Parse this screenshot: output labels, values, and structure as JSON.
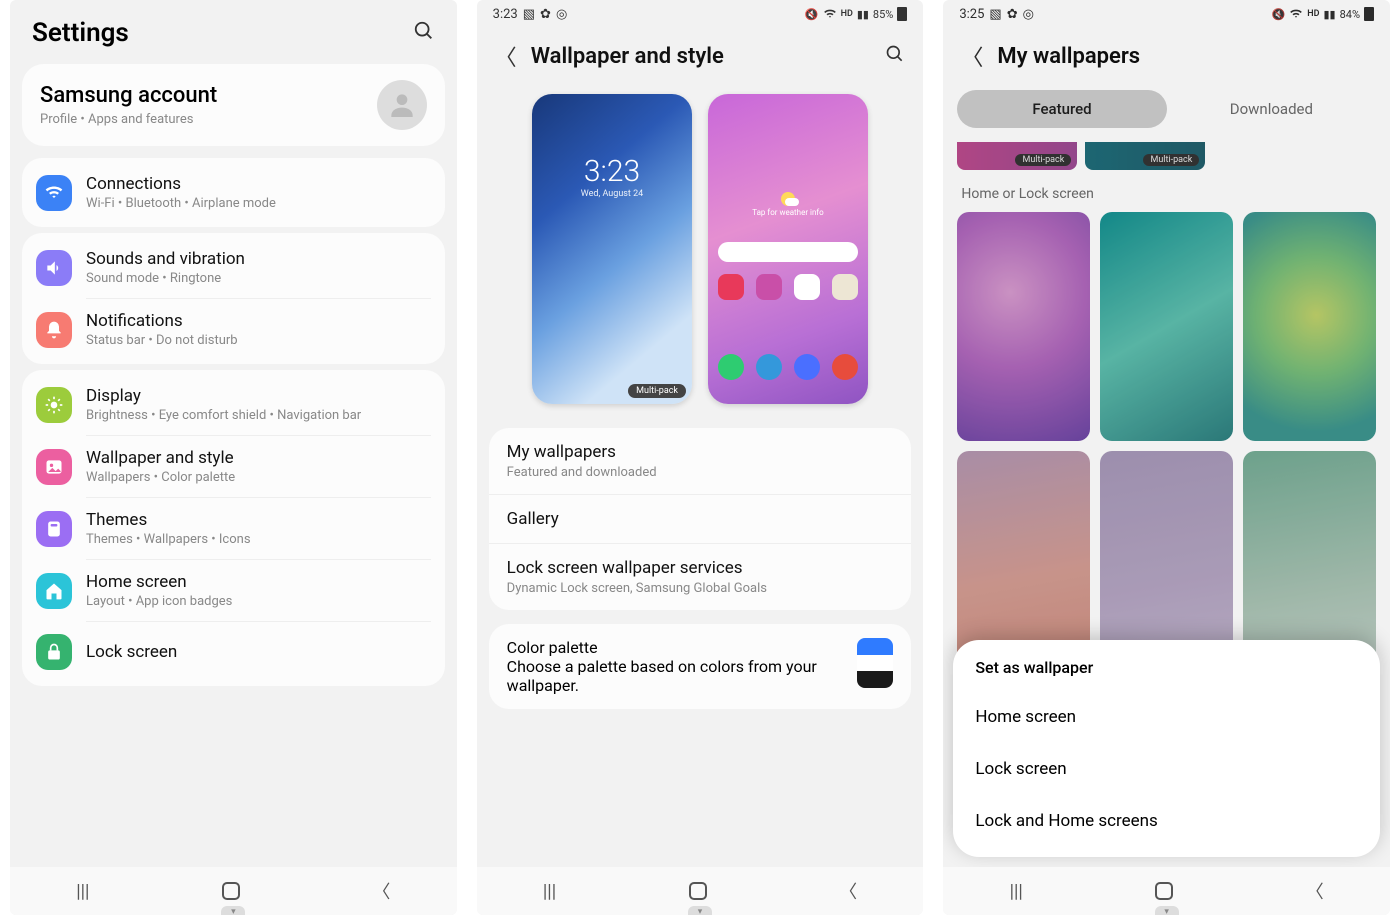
{
  "phone1": {
    "title": "Settings",
    "account": {
      "title": "Samsung account",
      "sub": "Profile  •  Apps and features"
    },
    "groups": [
      {
        "items": [
          {
            "icon": "wifi",
            "color": "#3b82f6",
            "title": "Connections",
            "sub": "Wi-Fi  •  Bluetooth  •  Airplane mode"
          }
        ]
      },
      {
        "items": [
          {
            "icon": "sound",
            "color": "#8b7cf7",
            "title": "Sounds and vibration",
            "sub": "Sound mode  •  Ringtone"
          },
          {
            "icon": "bell",
            "color": "#f77b72",
            "title": "Notifications",
            "sub": "Status bar  •  Do not disturb"
          }
        ]
      },
      {
        "items": [
          {
            "icon": "sun",
            "color": "#9ccc3c",
            "title": "Display",
            "sub": "Brightness  •  Eye comfort shield  •  Navigation bar"
          },
          {
            "icon": "image",
            "color": "#ec5fa0",
            "title": "Wallpaper and style",
            "sub": "Wallpapers  •  Color palette"
          },
          {
            "icon": "theme",
            "color": "#9b6ef3",
            "title": "Themes",
            "sub": "Themes  •  Wallpapers  •  Icons"
          },
          {
            "icon": "home",
            "color": "#2bc4d8",
            "title": "Home screen",
            "sub": "Layout  •  App icon badges"
          },
          {
            "icon": "lock",
            "color": "#35b36f",
            "title": "Lock screen",
            "sub": ""
          }
        ]
      }
    ]
  },
  "phone2": {
    "status": {
      "time": "3:23",
      "battery": "85%"
    },
    "title": "Wallpaper and style",
    "lock_preview": {
      "time": "3:23",
      "date": "Wed, August 24",
      "badge": "Multi-pack"
    },
    "home_preview": {
      "weather": "Tap for weather info"
    },
    "items": [
      {
        "title": "My wallpapers",
        "sub": "Featured and downloaded"
      },
      {
        "title": "Gallery",
        "sub": ""
      },
      {
        "title": "Lock screen wallpaper services",
        "sub": "Dynamic Lock screen, Samsung Global Goals"
      }
    ],
    "palette": {
      "title": "Color palette",
      "sub": "Choose a palette based on colors from your wallpaper."
    }
  },
  "phone3": {
    "status": {
      "time": "3:25",
      "battery": "84%"
    },
    "title": "My wallpapers",
    "tabs": {
      "active": "Featured",
      "other": "Downloaded"
    },
    "strip_badge": "Multi-pack",
    "section": "Home or Lock screen",
    "sheet": {
      "title": "Set as wallpaper",
      "options": [
        "Home screen",
        "Lock screen",
        "Lock and Home screens"
      ]
    }
  },
  "status_icons": {
    "hd": "HD"
  }
}
